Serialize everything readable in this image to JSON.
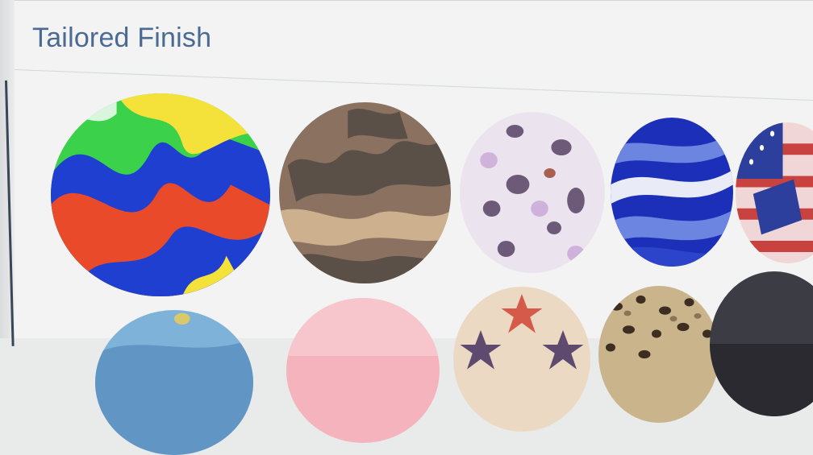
{
  "section": {
    "title": "Tailored Finish"
  },
  "swatches": [
    {
      "name": "psychedelic-swirl",
      "colors": [
        "#3bd14a",
        "#e84a2a",
        "#1f3fd0",
        "#f4e23a",
        "#ffffff"
      ]
    },
    {
      "name": "camouflage",
      "colors": [
        "#8b7160",
        "#5b5048",
        "#cdb08e",
        "#a68570"
      ]
    },
    {
      "name": "butterflies",
      "colors": [
        "#ebe4ee",
        "#c9a6d6",
        "#6d5a78",
        "#a85f4e"
      ]
    },
    {
      "name": "blue-marble",
      "colors": [
        "#1c2fb8",
        "#6c85e0",
        "#e9ecf7",
        "#2b44c9"
      ]
    },
    {
      "name": "american-flag",
      "colors": [
        "#c8433f",
        "#f0d6d6",
        "#2c3f9c",
        "#ffffff"
      ]
    },
    {
      "name": "sky-blue",
      "colors": [
        "#7fb2d8",
        "#4d82b8",
        "#d9c96a"
      ]
    },
    {
      "name": "pink",
      "colors": [
        "#f4b3bd",
        "#f7c6cc"
      ]
    },
    {
      "name": "stars",
      "colors": [
        "#ecd9c3",
        "#d65a4a",
        "#5d4a6e"
      ]
    },
    {
      "name": "leopard",
      "colors": [
        "#c9b48c",
        "#3e2e22",
        "#8d7254"
      ]
    },
    {
      "name": "charcoal",
      "colors": [
        "#3c3c44",
        "#2a2a30"
      ]
    }
  ]
}
